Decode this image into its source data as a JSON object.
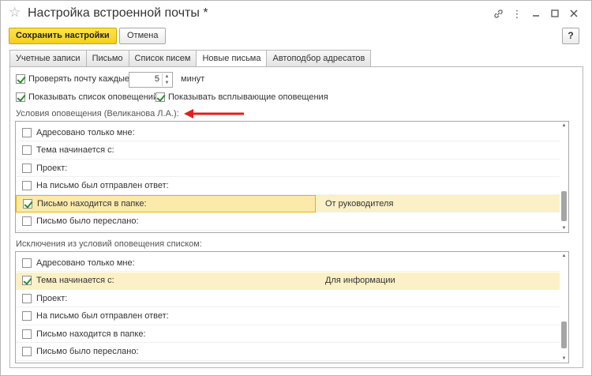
{
  "window": {
    "title": "Настройка встроенной почты *",
    "icons": [
      "star-icon",
      "link-icon",
      "more-icon",
      "minimize-icon",
      "maximize-icon",
      "close-icon"
    ]
  },
  "toolbar": {
    "save_label": "Сохранить настройки",
    "cancel_label": "Отмена",
    "help_label": "?"
  },
  "tabs": [
    {
      "label": "Учетные записи",
      "active": false
    },
    {
      "label": "Письмо",
      "active": false
    },
    {
      "label": "Список писем",
      "active": false
    },
    {
      "label": "Новые письма",
      "active": true
    },
    {
      "label": "Автоподбор адресатов",
      "active": false
    }
  ],
  "check_mail": {
    "label": "Проверять почту каждые:",
    "checked": true,
    "interval": "5",
    "unit": "минут"
  },
  "show_notifications_list": {
    "label": "Показывать список оповещений",
    "checked": true
  },
  "show_popup_notifications": {
    "label": "Показывать всплывающие оповещения",
    "checked": true
  },
  "conditions": {
    "title": "Условия оповещения (Великанова Л.А.):",
    "accent_color": "#e0201e",
    "rows": [
      {
        "label": "Адресовано только мне:",
        "checked": false,
        "value": ""
      },
      {
        "label": "Тема начинается с:",
        "checked": false,
        "value": ""
      },
      {
        "label": "Проект:",
        "checked": false,
        "value": ""
      },
      {
        "label": "На письмо был отправлен ответ:",
        "checked": false,
        "value": ""
      },
      {
        "label": "Письмо находится в папке:",
        "checked": true,
        "value": "От руководителя"
      },
      {
        "label": "Письмо было переслано:",
        "checked": false,
        "value": ""
      }
    ]
  },
  "exceptions": {
    "title": "Исключения из условий оповещения списком:",
    "rows": [
      {
        "label": "Адресовано только мне:",
        "checked": false,
        "value": ""
      },
      {
        "label": "Тема начинается с:",
        "checked": true,
        "value": "Для информации"
      },
      {
        "label": "Проект:",
        "checked": false,
        "value": ""
      },
      {
        "label": "На письмо был отправлен ответ:",
        "checked": false,
        "value": ""
      },
      {
        "label": "Письмо находится в папке:",
        "checked": false,
        "value": ""
      },
      {
        "label": "Письмо было переслано:",
        "checked": false,
        "value": ""
      }
    ]
  },
  "colors": {
    "save_button": "#f5cf1e",
    "row_highlight": "#fbf0c6",
    "checkmark": "#2e8b2e"
  }
}
